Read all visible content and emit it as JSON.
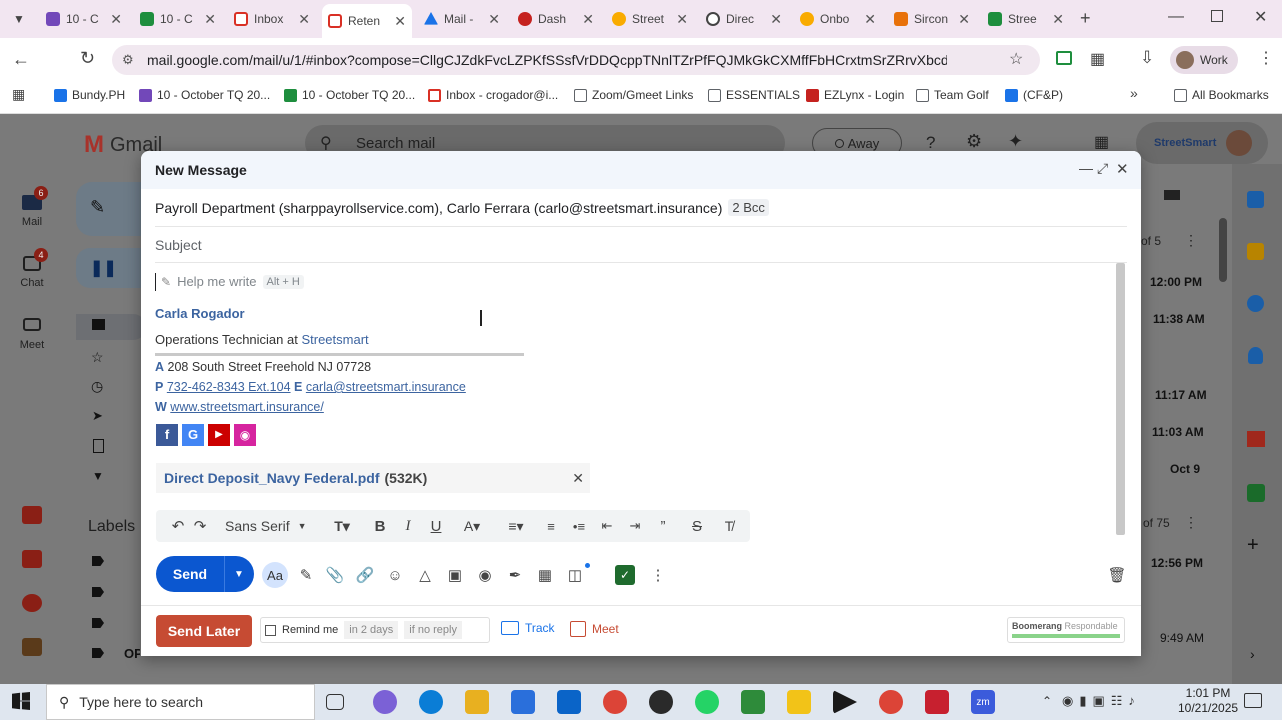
{
  "browser": {
    "tabs": [
      {
        "label": "10 - C",
        "color": "#7248b9"
      },
      {
        "label": "10 - C",
        "color": "#1e8e3e"
      },
      {
        "label": "Inbox",
        "color": "#d93025"
      },
      {
        "label": "Reten",
        "color": "#d93025"
      },
      {
        "label": "Mail -",
        "color": "#1a73e8"
      },
      {
        "label": "Dash",
        "color": "#c5221f"
      },
      {
        "label": "Street",
        "color": "#f9ab00"
      },
      {
        "label": "Direc",
        "color": "#444444"
      },
      {
        "label": "Onbo",
        "color": "#f9ab00"
      },
      {
        "label": "Sircon",
        "color": "#e8710a"
      },
      {
        "label": "Stree",
        "color": "#1e8e3e"
      }
    ],
    "url": "mail.google.com/mail/u/1/#inbox?compose=CllgCJZdkFvcLZPKfSSsfVrDDQcppTNnlTZrPfFQJMkGkCXMffFbHCrxtmSrZRrvXbcddRDmL",
    "profile_label": "Work",
    "bookmarks": [
      {
        "label": "Bundy.PH",
        "color": "#1a73e8"
      },
      {
        "label": "10 - October TQ 20...",
        "color": "#7248b9"
      },
      {
        "label": "10 - October TQ 20...",
        "color": "#1e8e3e"
      },
      {
        "label": "Inbox - crogador@i...",
        "color": "#d93025"
      },
      {
        "label": "Zoom/Gmeet Links",
        "color": "#5f6368"
      },
      {
        "label": "ESSENTIALS",
        "color": "#5f6368"
      },
      {
        "label": "EZLynx - Login",
        "color": "#c5221f"
      },
      {
        "label": "Team Golf",
        "color": "#5f6368"
      },
      {
        "label": "(CF&P)",
        "color": "#1a73e8"
      }
    ],
    "all_bookmarks": "All Bookmarks"
  },
  "gmail": {
    "logo": "Gmail",
    "search_placeholder": "Search mail",
    "status": "Away",
    "org": "StreetSmart",
    "rail": [
      {
        "label": "Mail",
        "badge": "6"
      },
      {
        "label": "Chat",
        "badge": "4"
      },
      {
        "label": "Meet",
        "badge": ""
      }
    ],
    "labels_heading": "Labels",
    "times": [
      "12:00 PM",
      "11:38 AM",
      "11:17 AM",
      "11:03 AM",
      "Oct 9",
      "12:56 PM",
      "9:49 AM"
    ],
    "page_info_1": "of 5",
    "page_info_2": "of 75",
    "left_label": "OPERATIONS"
  },
  "compose": {
    "title": "New Message",
    "recipients": "Payroll Department (sharppayrollservice.com), Carlo Ferrara (carlo@streetsmart.insurance)",
    "bcc": "2 Bcc",
    "subject_placeholder": "Subject",
    "help_me_write": "Help me write",
    "help_shortcut": "Alt + H",
    "signature": {
      "name": "Carla Rogador",
      "title_prefix": "Operations Technician at ",
      "company": "Streetsmart",
      "address_label": "A",
      "address": "208 South Street Freehold NJ 07728",
      "phone_label": "P",
      "phone": "732-462-8343 Ext.104",
      "email_label": "E",
      "email": "carla@streetsmart.insurance",
      "web_label": "W",
      "web": "www.streetsmart.insurance/"
    },
    "attachment": {
      "name": "Direct Deposit_Navy Federal.pdf",
      "size": "(532K)"
    },
    "font": "Sans Serif",
    "send_label": "Send",
    "send_later_label": "Send Later",
    "remind_me": "Remind me",
    "remind_when": "in 2 days",
    "remind_cond": "if no reply",
    "track_label": "Track",
    "meet_label": "Meet",
    "boomerang": "Boomerang",
    "respondable": "Respondable"
  },
  "taskbar": {
    "search_placeholder": "Type here to search",
    "time": "1:01 PM",
    "date": "10/21/2025"
  }
}
